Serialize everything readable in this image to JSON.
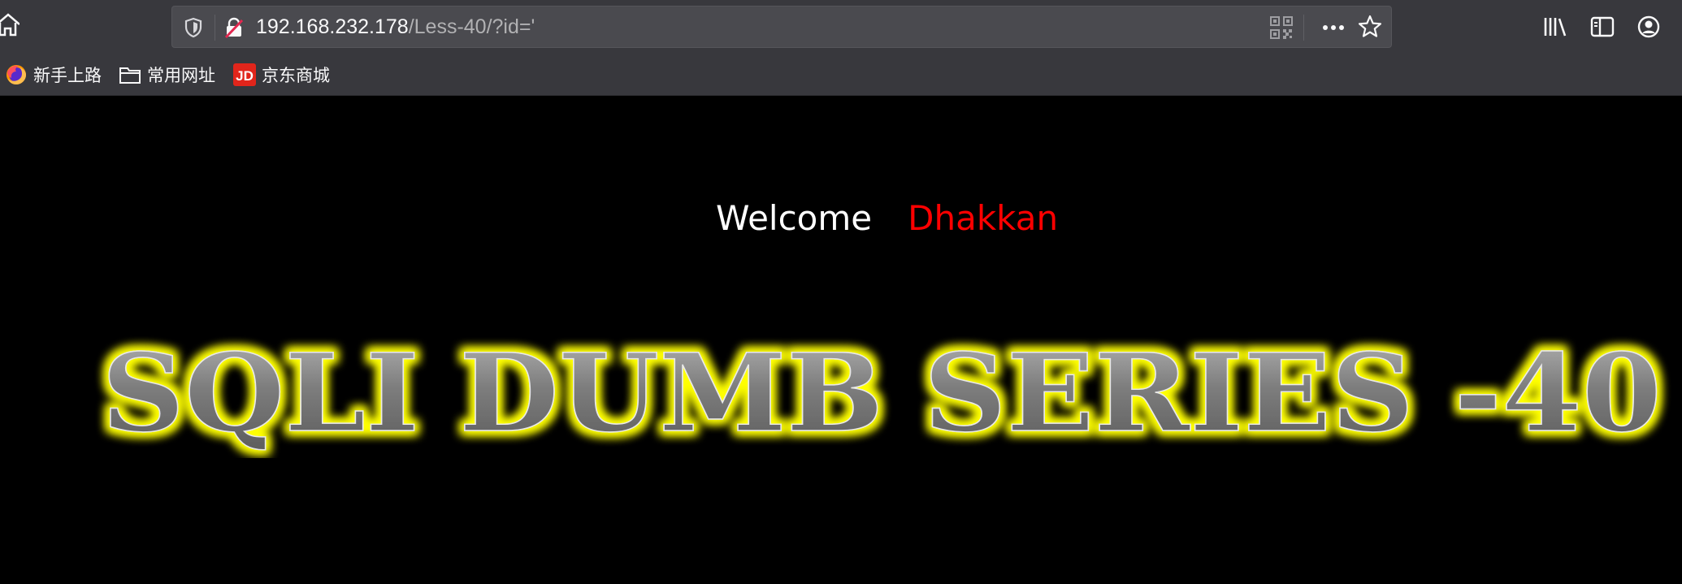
{
  "browser": {
    "url_host": "192.168.232.178",
    "url_path": "/Less-40/?id='",
    "icons": {
      "home": "home-icon",
      "tracking": "shield-icon",
      "insecure": "broken-lock-icon",
      "qr": "qr-code-icon",
      "more": "more-icon",
      "bookmark": "star-icon",
      "library": "library-icon",
      "sidebar": "sidebar-icon",
      "account": "account-icon"
    }
  },
  "bookmarks": [
    {
      "label": "新手上路",
      "icon": "firefox-icon"
    },
    {
      "label": "常用网址",
      "icon": "folder-icon"
    },
    {
      "label": "京东商城",
      "icon": "jd-icon"
    }
  ],
  "page": {
    "welcome": "Welcome",
    "user": "Dhakkan",
    "banner_text": "SQLI DUMB SERIES -40",
    "colors": {
      "background": "#000000",
      "welcome": "#ffffff",
      "user": "#ff0000",
      "banner_glow": "#ffff00",
      "banner_fill": "#8c8c8c"
    }
  }
}
